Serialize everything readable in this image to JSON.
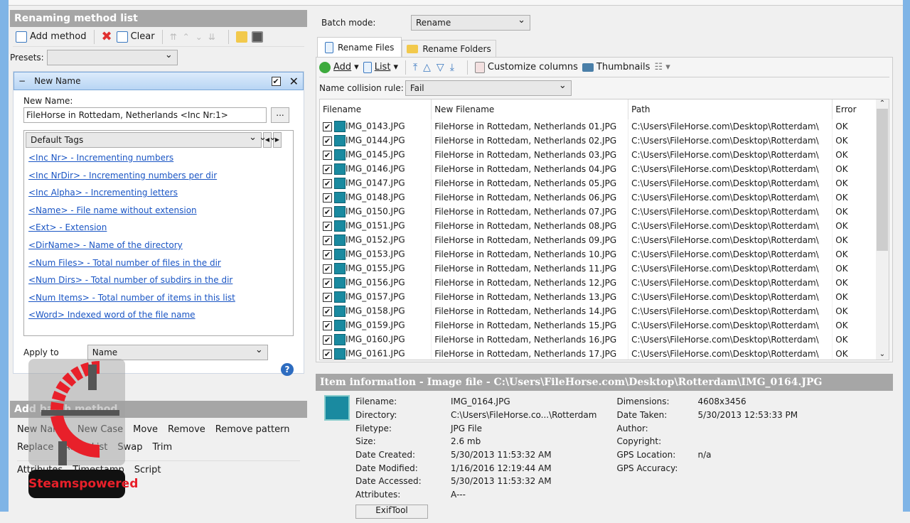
{
  "left": {
    "section_title": "Renaming method list",
    "toolbar": {
      "add_method": "Add method",
      "clear": "Clear"
    },
    "presets_label": "Presets:",
    "presets_value": "",
    "method": {
      "title": "New Name",
      "enabled": true,
      "new_name_label": "New Name:",
      "new_name_value": "FileHorse in Rottedam, Netherlands <Inc Nr:1>",
      "browse": "...",
      "tags_select": "Default Tags",
      "tags": [
        "<Inc Nr> - Incrementing numbers",
        "<Inc NrDir> - Incrementing numbers per dir",
        "<Inc Alpha> - Incrementing letters",
        "<Name> - File name without extension",
        "<Ext> - Extension",
        "<DirName> - Name of the directory",
        "<Num Files> - Total number of files in the dir",
        "<Num Dirs> - Total number of subdirs in the dir",
        "<Num Items> - Total number of items in this list",
        "<Word> Indexed word of the file name"
      ],
      "apply_label": "Apply to",
      "apply_value": "Name"
    },
    "batch_title": "Add batch method",
    "batch_row1": [
      "New Name",
      "New Case",
      "Move",
      "Remove",
      "Remove pattern"
    ],
    "batch_row2": [
      "Replace",
      "Add",
      "List",
      "Swap",
      "Trim"
    ],
    "batch_row3": [
      "Attributes",
      "Timestamp",
      "Script"
    ]
  },
  "right": {
    "batch_mode_label": "Batch mode:",
    "batch_mode_value": "Rename",
    "tabs": [
      "Rename Files",
      "Rename Folders"
    ],
    "toolbar": {
      "add": "Add",
      "list": "List",
      "customize": "Customize columns",
      "thumbnails": "Thumbnails"
    },
    "collision_label": "Name collision rule:",
    "collision_value": "Fail",
    "columns": [
      "Filename",
      "New Filename",
      "Path",
      "Error"
    ],
    "rows": [
      [
        "IMG_0143.JPG",
        "FileHorse in Rottedam, Netherlands 01.JPG",
        "C:\\Users\\FileHorse.com\\Desktop\\Rotterdam\\",
        "OK"
      ],
      [
        "IMG_0144.JPG",
        "FileHorse in Rottedam, Netherlands 02.JPG",
        "C:\\Users\\FileHorse.com\\Desktop\\Rotterdam\\",
        "OK"
      ],
      [
        "IMG_0145.JPG",
        "FileHorse in Rottedam, Netherlands 03.JPG",
        "C:\\Users\\FileHorse.com\\Desktop\\Rotterdam\\",
        "OK"
      ],
      [
        "IMG_0146.JPG",
        "FileHorse in Rottedam, Netherlands 04.JPG",
        "C:\\Users\\FileHorse.com\\Desktop\\Rotterdam\\",
        "OK"
      ],
      [
        "IMG_0147.JPG",
        "FileHorse in Rottedam, Netherlands 05.JPG",
        "C:\\Users\\FileHorse.com\\Desktop\\Rotterdam\\",
        "OK"
      ],
      [
        "IMG_0148.JPG",
        "FileHorse in Rottedam, Netherlands 06.JPG",
        "C:\\Users\\FileHorse.com\\Desktop\\Rotterdam\\",
        "OK"
      ],
      [
        "IMG_0150.JPG",
        "FileHorse in Rottedam, Netherlands 07.JPG",
        "C:\\Users\\FileHorse.com\\Desktop\\Rotterdam\\",
        "OK"
      ],
      [
        "IMG_0151.JPG",
        "FileHorse in Rottedam, Netherlands 08.JPG",
        "C:\\Users\\FileHorse.com\\Desktop\\Rotterdam\\",
        "OK"
      ],
      [
        "IMG_0152.JPG",
        "FileHorse in Rottedam, Netherlands 09.JPG",
        "C:\\Users\\FileHorse.com\\Desktop\\Rotterdam\\",
        "OK"
      ],
      [
        "IMG_0153.JPG",
        "FileHorse in Rottedam, Netherlands 10.JPG",
        "C:\\Users\\FileHorse.com\\Desktop\\Rotterdam\\",
        "OK"
      ],
      [
        "IMG_0155.JPG",
        "FileHorse in Rottedam, Netherlands 11.JPG",
        "C:\\Users\\FileHorse.com\\Desktop\\Rotterdam\\",
        "OK"
      ],
      [
        "IMG_0156.JPG",
        "FileHorse in Rottedam, Netherlands 12.JPG",
        "C:\\Users\\FileHorse.com\\Desktop\\Rotterdam\\",
        "OK"
      ],
      [
        "IMG_0157.JPG",
        "FileHorse in Rottedam, Netherlands 13.JPG",
        "C:\\Users\\FileHorse.com\\Desktop\\Rotterdam\\",
        "OK"
      ],
      [
        "IMG_0158.JPG",
        "FileHorse in Rottedam, Netherlands 14.JPG",
        "C:\\Users\\FileHorse.com\\Desktop\\Rotterdam\\",
        "OK"
      ],
      [
        "IMG_0159.JPG",
        "FileHorse in Rottedam, Netherlands 15.JPG",
        "C:\\Users\\FileHorse.com\\Desktop\\Rotterdam\\",
        "OK"
      ],
      [
        "IMG_0160.JPG",
        "FileHorse in Rottedam, Netherlands 16.JPG",
        "C:\\Users\\FileHorse.com\\Desktop\\Rotterdam\\",
        "OK"
      ],
      [
        "IMG_0161.JPG",
        "FileHorse in Rottedam, Netherlands 17.JPG",
        "C:\\Users\\FileHorse.com\\Desktop\\Rotterdam\\",
        "OK"
      ]
    ],
    "info_title": "Item information - Image file - C:\\Users\\FileHorse.com\\Desktop\\Rotterdam\\IMG_0164.JPG",
    "info_left": [
      [
        "Filename:",
        "IMG_0164.JPG"
      ],
      [
        "Directory:",
        "C:\\Users\\FileHorse.co...\\Rotterdam"
      ],
      [
        "Filetype:",
        "JPG File"
      ],
      [
        "Size:",
        "2.6 mb"
      ],
      [
        "Date Created:",
        "5/30/2013 11:53:32 AM"
      ],
      [
        "Date Modified:",
        "1/16/2016 12:19:44 AM"
      ],
      [
        "Date Accessed:",
        "5/30/2013 11:53:32 AM"
      ],
      [
        "Attributes:",
        "A---"
      ]
    ],
    "info_right": [
      [
        "Dimensions:",
        "4608x3456"
      ],
      [
        "Date Taken:",
        "5/30/2013 12:53:33 PM"
      ],
      [
        "Author:",
        ""
      ],
      [
        "Copyright:",
        ""
      ],
      [
        "GPS Location:",
        "n/a"
      ],
      [
        "GPS Accuracy:",
        ""
      ]
    ],
    "exiftool": "ExifTool"
  },
  "watermark": {
    "text": "Steamspowered",
    "color": "#e8202a"
  },
  "colors": {
    "section": "#a6a6a6",
    "link": "#1a55c4",
    "accent": "#7fb4e6"
  }
}
